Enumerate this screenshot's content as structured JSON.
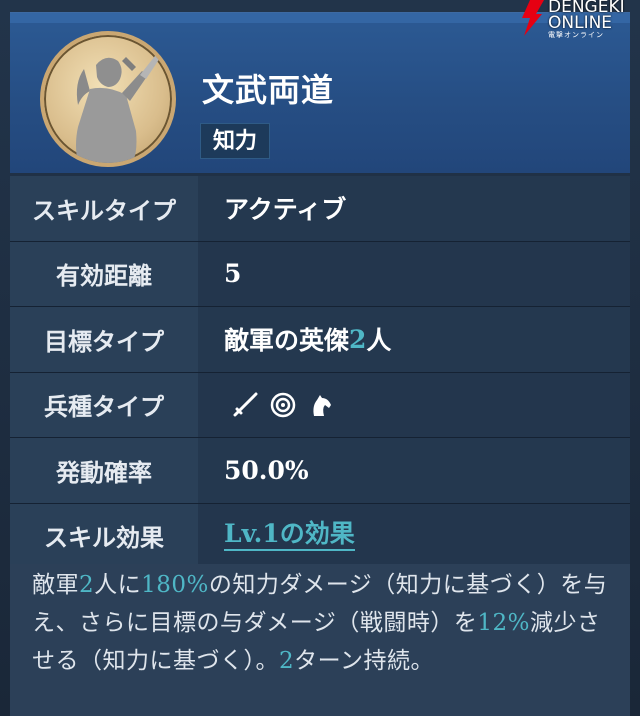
{
  "brand": {
    "line1": "DENGEKI",
    "line2": "ONLINE",
    "line3": "電撃オンライン",
    "color": "#e60012"
  },
  "skill": {
    "name": "文武両道",
    "category": "知力",
    "portrait_icon": "warrior-silhouette-icon"
  },
  "rows": [
    {
      "label": "スキルタイプ",
      "value": "アクティブ"
    },
    {
      "label": "有効距離",
      "value": "5"
    },
    {
      "label": "目標タイプ",
      "value_pre": "敵軍の英傑",
      "value_num": "2",
      "value_post": "人"
    },
    {
      "label": "兵種タイプ",
      "icons": [
        "sword-icon",
        "target-icon",
        "horse-icon"
      ]
    },
    {
      "label": "発動確率",
      "value": "50.0%"
    },
    {
      "label": "スキル効果",
      "value": "Lv.1の効果"
    }
  ],
  "description": {
    "p1": "敵軍",
    "n1": "2",
    "p2": "人に",
    "n2": "180%",
    "p3": "の知力ダメージ（知力に基づく）を与え、さらに目標の与ダメージ（戦闘時）を",
    "n3": "12%",
    "p4": "減少させる（知力に基づく）。",
    "n4": "2",
    "p5": "ターン持続。"
  },
  "colors": {
    "accent_teal": "#4fb7c6",
    "header_blue": "#2c5a94"
  }
}
